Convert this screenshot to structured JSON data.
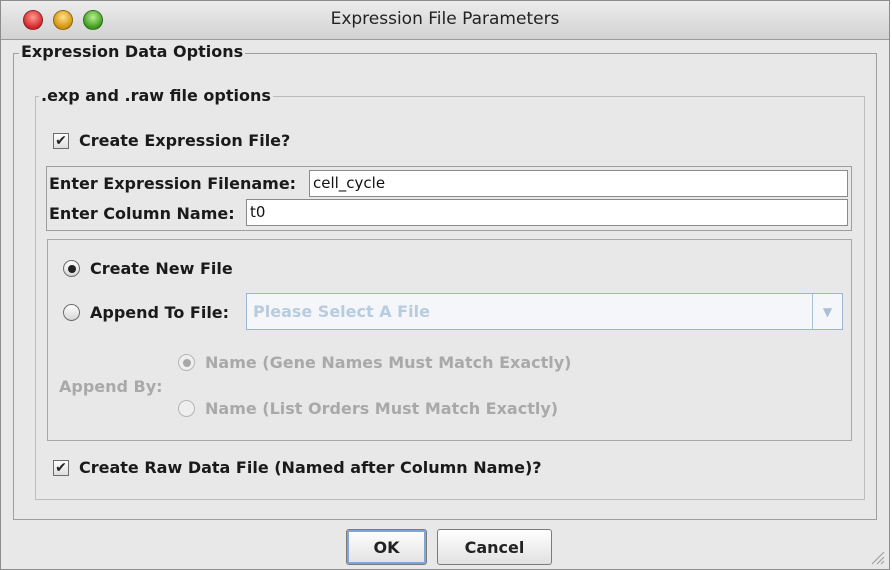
{
  "window": {
    "title": "Expression File Parameters"
  },
  "expression_options": {
    "legend": "Expression Data Options",
    "file_options": {
      "legend": ".exp  and .raw file options",
      "create_expression_file": {
        "label": "Create Expression File?",
        "checked": true
      },
      "filename": {
        "label": "Enter Expression Filename:",
        "value": "cell_cycle"
      },
      "column_name": {
        "label": "Enter Column Name:",
        "value": "t0"
      },
      "mode": {
        "create_new": {
          "label": "Create New File",
          "selected": true
        },
        "append": {
          "label": "Append To File:",
          "selected": false
        },
        "append_combo": {
          "value": "Please Select A File"
        },
        "append_by": {
          "label": "Append By:",
          "options": [
            {
              "label": "Name (Gene Names Must Match Exactly)",
              "selected": true
            },
            {
              "label": "Name (List Orders Must Match Exactly)",
              "selected": false
            }
          ]
        }
      },
      "create_raw_file": {
        "label": "Create Raw Data File (Named after Column Name)?",
        "checked": true
      }
    }
  },
  "buttons": {
    "ok": "OK",
    "cancel": "Cancel"
  },
  "icons": {
    "checkmark": "✔",
    "dropdown": "▼"
  },
  "colors": {
    "disabled_text": "#a9a9a9",
    "combo_placeholder": "#b8cce0",
    "default_button_ring": "#7fa6d6"
  }
}
